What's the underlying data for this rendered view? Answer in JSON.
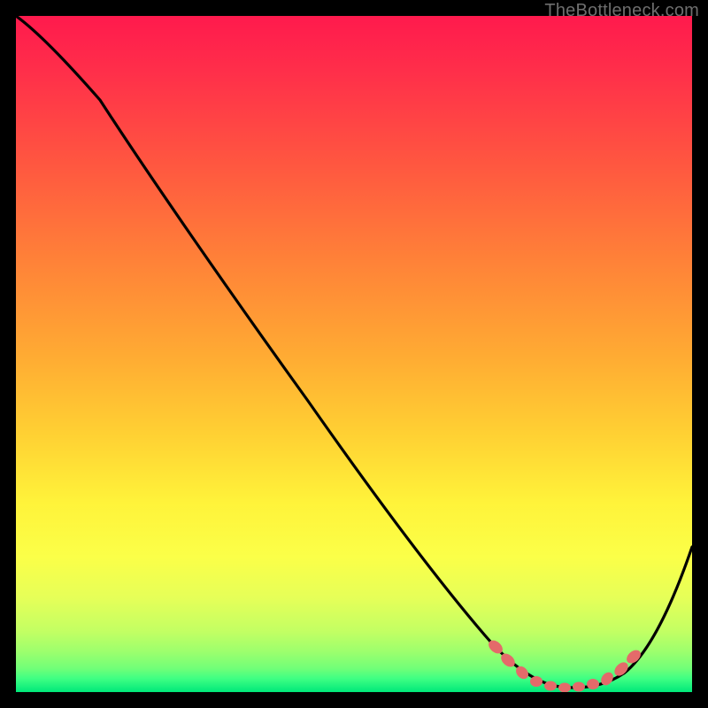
{
  "watermark": "TheBottleneck.com",
  "chart_data": {
    "type": "line",
    "title": "",
    "xlabel": "",
    "ylabel": "",
    "xlim": [
      0,
      100
    ],
    "ylim": [
      0,
      100
    ],
    "grid": false,
    "legend": false,
    "background": "rainbow-vertical-gradient (red top → green bottom)",
    "series": [
      {
        "name": "bottleneck-curve",
        "color": "#000000",
        "x": [
          0,
          3,
          12,
          25,
          40,
          55,
          65,
          72,
          76,
          80,
          84,
          88,
          92,
          100
        ],
        "y": [
          100,
          98,
          90,
          72,
          51,
          30,
          16,
          6,
          2,
          0.5,
          0.5,
          2,
          6,
          24
        ]
      }
    ],
    "markers": {
      "name": "optimal-range-dots",
      "color": "#e46a6a",
      "x": [
        71,
        73,
        75,
        77,
        79,
        81,
        83,
        85,
        87,
        89,
        91
      ],
      "y": [
        4.5,
        2.8,
        1.6,
        1.0,
        0.6,
        0.5,
        0.6,
        1.0,
        1.6,
        2.8,
        4.5
      ]
    }
  }
}
